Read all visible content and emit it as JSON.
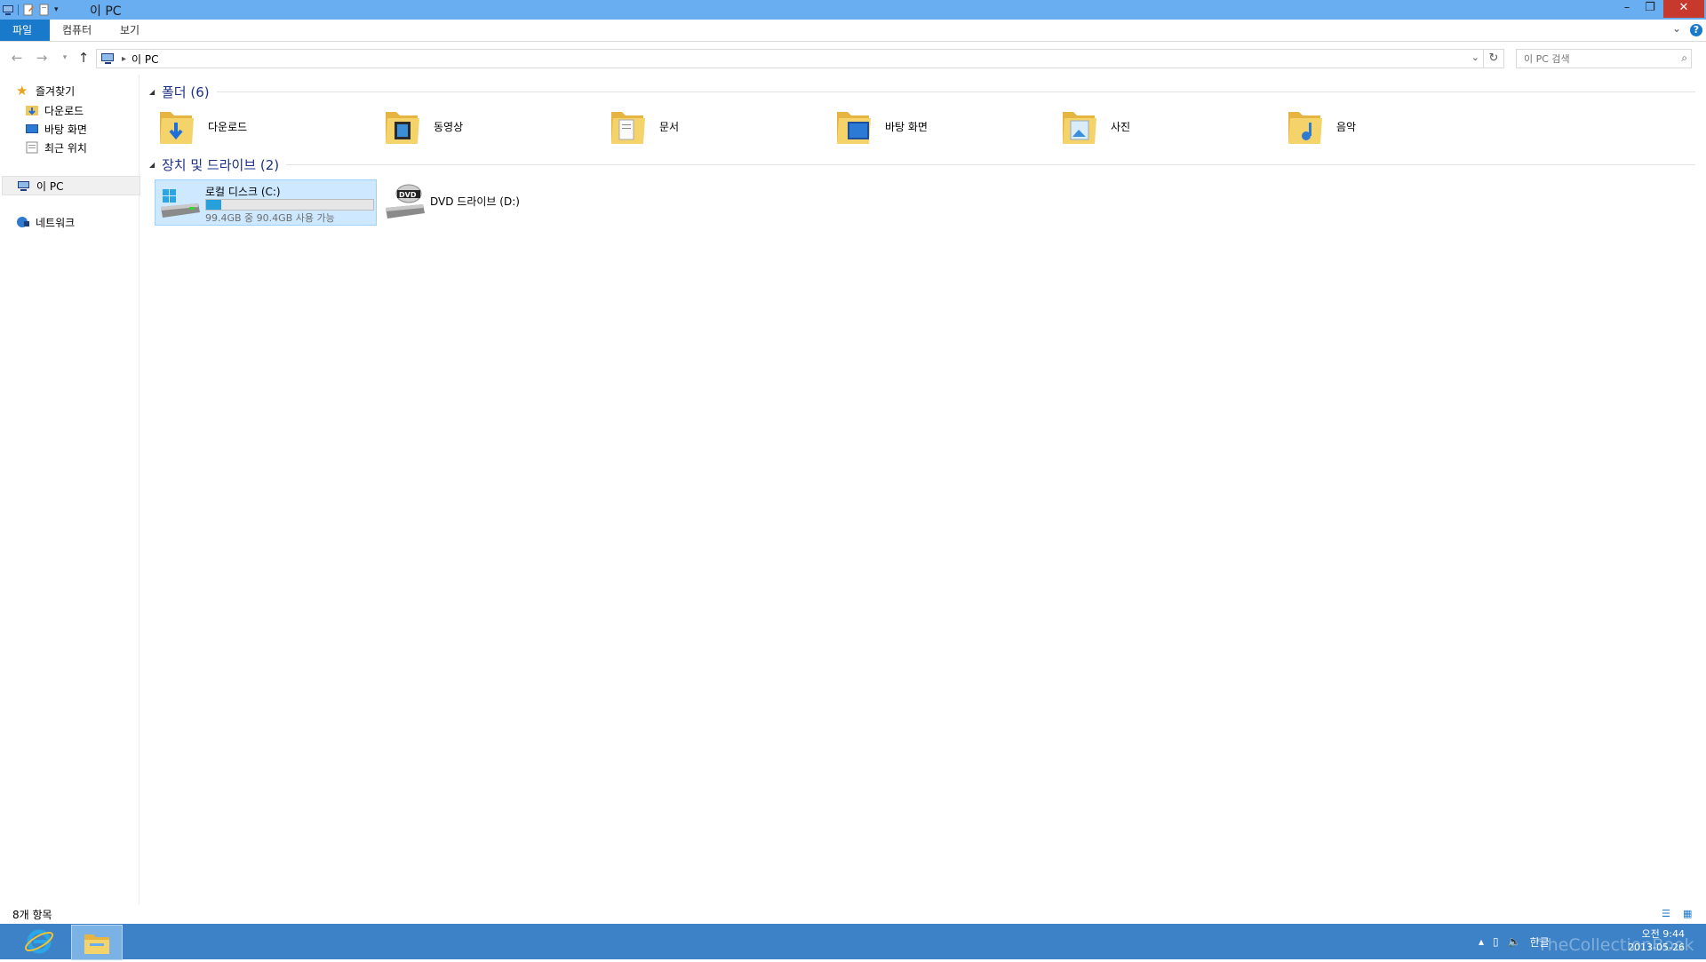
{
  "window": {
    "title": "이 PC"
  },
  "ribbon": {
    "tabs": [
      "파일",
      "컴퓨터",
      "보기"
    ]
  },
  "address": {
    "path": "이 PC",
    "search_placeholder": "이 PC 검색"
  },
  "nav": {
    "favorites": "즐겨찾기",
    "favorite_items": [
      "다운로드",
      "바탕 화면",
      "최근 위치"
    ],
    "this_pc": "이 PC",
    "network": "네트워크"
  },
  "content": {
    "folders_header": "폴더 (6)",
    "folders": [
      "다운로드",
      "동영상",
      "문서",
      "바탕 화면",
      "사진",
      "음악"
    ],
    "drives_header": "장치 및 드라이브 (2)",
    "drives": [
      {
        "name": "로컬 디스크 (C:)",
        "sub": "99.4GB 중 90.4GB 사용 가능",
        "used_fraction": 0.09
      },
      {
        "name": "DVD 드라이브 (D:)"
      }
    ]
  },
  "status": {
    "count": "8개 항목"
  },
  "taskbar": {
    "lang": "한글",
    "time": "오전 9:44",
    "date": "2013-05-26",
    "watermark": "TheCollectionBook"
  },
  "colors": {
    "titlebar": "#6aaef2",
    "accent": "#1979ca",
    "taskbar": "#3d82c7",
    "close": "#c7382d"
  }
}
